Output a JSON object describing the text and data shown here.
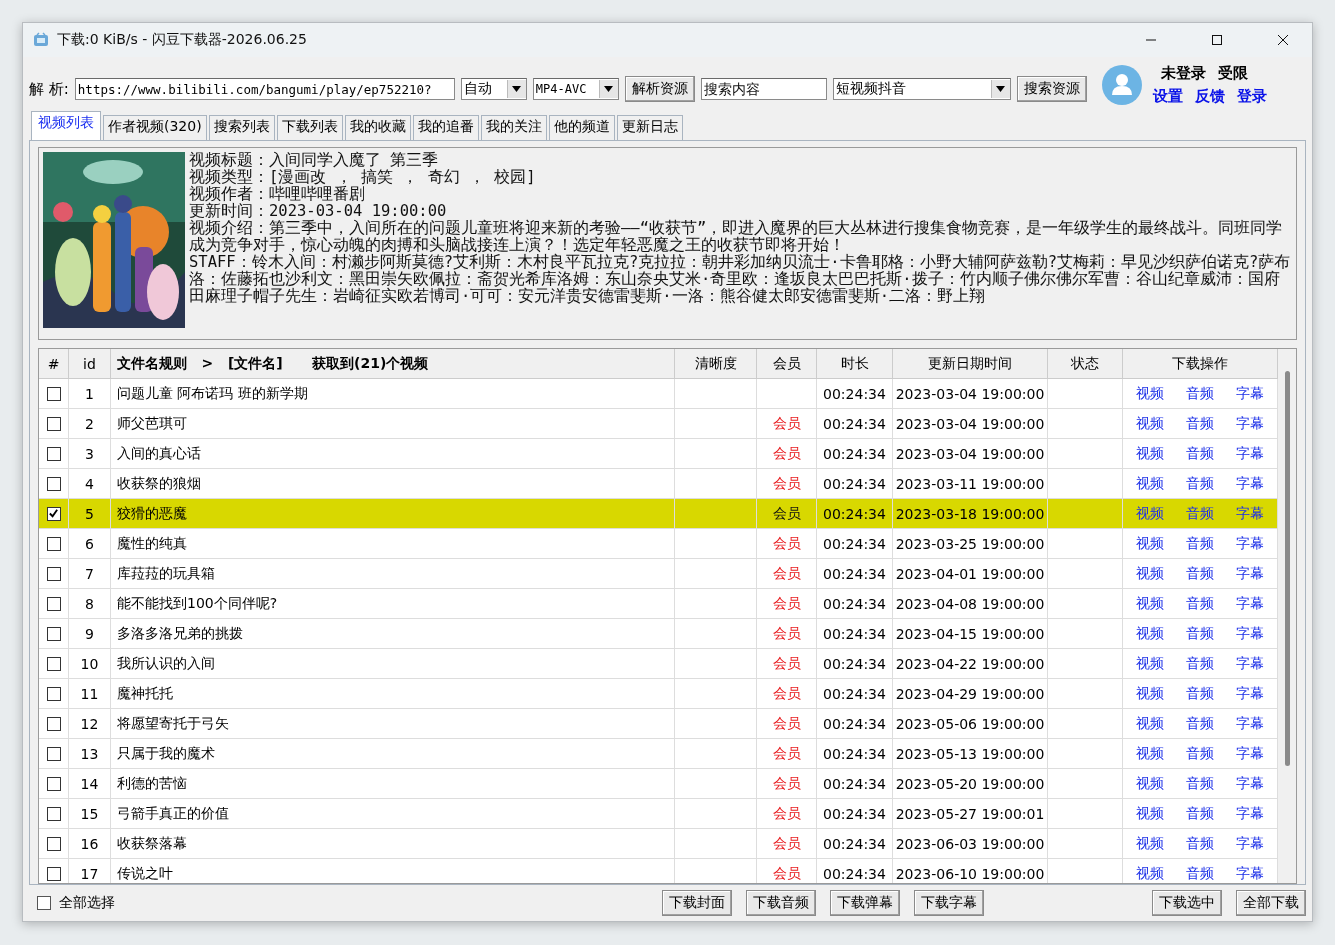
{
  "window": {
    "title": "下载:0 KiB/s - 闪豆下载器-2026.06.25"
  },
  "toolbar": {
    "parse_label": "解 析:",
    "url": "https://www.bilibili.com/bangumi/play/ep752210?",
    "quality": "自动",
    "codec": "MP4-AVC",
    "parse_button": "解析资源",
    "search_placeholder": "搜索内容",
    "platform": "短视频抖音",
    "search_button": "搜索资源"
  },
  "account": {
    "status": "未登录",
    "limit": "受限",
    "links": [
      "设置",
      "反馈",
      "登录"
    ]
  },
  "tabs": [
    {
      "label": "视频列表",
      "selected": true
    },
    {
      "label": "作者视频(320)",
      "selected": false
    },
    {
      "label": "搜索列表",
      "selected": false
    },
    {
      "label": "下载列表",
      "selected": false
    },
    {
      "label": "我的收藏",
      "selected": false
    },
    {
      "label": "我的追番",
      "selected": false
    },
    {
      "label": "我的关注",
      "selected": false
    },
    {
      "label": "他的频道",
      "selected": false
    },
    {
      "label": "更新日志",
      "selected": false
    }
  ],
  "info": {
    "lines": [
      "视频标题：入间同学入魔了 第三季",
      "视频类型：[漫画改 ， 搞笑 ， 奇幻 ， 校园]",
      "视频作者：哔哩哔哩番剧",
      "更新时间：2023-03-04 19:00:00",
      "视频介绍：第三季中，入间所在的问题儿童班将迎来新的考验——“收获节”，即进入魔界的巨大丛林进行搜集食物竞赛，是一年级学生的最终战斗。同班同学成为竞争对手，惊心动魄的肉搏和头脑战接连上演？！选定年轻恶魔之王的收获节即将开始！",
      "STAFF：铃木入间：村濑步阿斯莫德?艾利斯：木村良平瓦拉克?克拉拉：朝井彩加纳贝流士·卡鲁耶格：小野大辅阿萨兹勒?艾梅莉：早见沙织萨伯诺克?萨布洛：佐藤拓也沙利文：黑田崇矢欧佩拉：斋贺光希库洛姆：东山奈央艾米·奇里欧：逢坂良太巴巴托斯·拨子：竹内顺子佛尔佛尔军曹：谷山纪章威沛：国府田麻理子帽子先生：岩崎征实欧若博司·可可：安元洋贵安德雷斐斯·一洛：熊谷健太郎安德雷斐斯·二洛：野上翔"
    ]
  },
  "table": {
    "columns": [
      "#",
      "id",
      "文件名规则   >   [文件名]      获取到(21)个视频",
      "清晰度",
      "会员",
      "时长",
      "更新日期时间",
      "状态",
      "下载操作"
    ],
    "rows": [
      {
        "id": "1",
        "name": "问题儿童 阿布诺玛 班的新学期",
        "duration": "00:24:34",
        "date": "2023-03-04 19:00:00",
        "actions": [
          "视频",
          "音频",
          "字幕"
        ],
        "checked": false,
        "selected": false
      },
      {
        "id": "2",
        "name": "师父芭琪可",
        "member": "会员",
        "duration": "00:24:34",
        "date": "2023-03-04 19:00:00",
        "actions": [
          "视频",
          "音频",
          "字幕"
        ],
        "checked": false,
        "selected": false
      },
      {
        "id": "3",
        "name": "入间的真心话",
        "member": "会员",
        "duration": "00:24:34",
        "date": "2023-03-04 19:00:00",
        "actions": [
          "视频",
          "音频",
          "字幕"
        ],
        "checked": false,
        "selected": false
      },
      {
        "id": "4",
        "name": "收获祭的狼烟",
        "member": "会员",
        "duration": "00:24:34",
        "date": "2023-03-11 19:00:00",
        "actions": [
          "视频",
          "音频",
          "字幕"
        ],
        "checked": false,
        "selected": false
      },
      {
        "id": "5",
        "name": "狡猾的恶魔",
        "member": "会员",
        "duration": "00:24:34",
        "date": "2023-03-18 19:00:00",
        "actions": [
          "视频",
          "音频",
          "字幕"
        ],
        "checked": true,
        "selected": true
      },
      {
        "id": "6",
        "name": "魔性的纯真",
        "member": "会员",
        "duration": "00:24:34",
        "date": "2023-03-25 19:00:00",
        "actions": [
          "视频",
          "音频",
          "字幕"
        ],
        "checked": false,
        "selected": false
      },
      {
        "id": "7",
        "name": "库菈菈的玩具箱",
        "member": "会员",
        "duration": "00:24:34",
        "date": "2023-04-01 19:00:00",
        "actions": [
          "视频",
          "音频",
          "字幕"
        ],
        "checked": false,
        "selected": false
      },
      {
        "id": "8",
        "name": "能不能找到100个同伴呢?",
        "member": "会员",
        "duration": "00:24:34",
        "date": "2023-04-08 19:00:00",
        "actions": [
          "视频",
          "音频",
          "字幕"
        ],
        "checked": false,
        "selected": false
      },
      {
        "id": "9",
        "name": "多洛多洛兄弟的挑拨",
        "member": "会员",
        "duration": "00:24:34",
        "date": "2023-04-15 19:00:00",
        "actions": [
          "视频",
          "音频",
          "字幕"
        ],
        "checked": false,
        "selected": false
      },
      {
        "id": "10",
        "name": "我所认识的入间",
        "member": "会员",
        "duration": "00:24:34",
        "date": "2023-04-22 19:00:00",
        "actions": [
          "视频",
          "音频",
          "字幕"
        ],
        "checked": false,
        "selected": false
      },
      {
        "id": "11",
        "name": "魔神托托",
        "member": "会员",
        "duration": "00:24:34",
        "date": "2023-04-29 19:00:00",
        "actions": [
          "视频",
          "音频",
          "字幕"
        ],
        "checked": false,
        "selected": false
      },
      {
        "id": "12",
        "name": "将愿望寄托于弓矢",
        "member": "会员",
        "duration": "00:24:34",
        "date": "2023-05-06 19:00:00",
        "actions": [
          "视频",
          "音频",
          "字幕"
        ],
        "checked": false,
        "selected": false
      },
      {
        "id": "13",
        "name": "只属于我的魔术",
        "member": "会员",
        "duration": "00:24:34",
        "date": "2023-05-13 19:00:00",
        "actions": [
          "视频",
          "音频",
          "字幕"
        ],
        "checked": false,
        "selected": false
      },
      {
        "id": "14",
        "name": "利德的苦恼",
        "member": "会员",
        "duration": "00:24:34",
        "date": "2023-05-20 19:00:00",
        "actions": [
          "视频",
          "音频",
          "字幕"
        ],
        "checked": false,
        "selected": false
      },
      {
        "id": "15",
        "name": "弓箭手真正的价值",
        "member": "会员",
        "duration": "00:24:34",
        "date": "2023-05-27 19:00:01",
        "actions": [
          "视频",
          "音频",
          "字幕"
        ],
        "checked": false,
        "selected": false
      },
      {
        "id": "16",
        "name": "收获祭落幕",
        "member": "会员",
        "duration": "00:24:34",
        "date": "2023-06-03 19:00:00",
        "actions": [
          "视频",
          "音频",
          "字幕"
        ],
        "checked": false,
        "selected": false
      },
      {
        "id": "17",
        "name": "传说之叶",
        "member": "会员",
        "duration": "00:24:34",
        "date": "2023-06-10 19:00:00",
        "actions": [
          "视频",
          "音频",
          "字幕"
        ],
        "checked": false,
        "selected": false
      }
    ]
  },
  "footer": {
    "select_all": {
      "label": "全部选择",
      "checked": false
    },
    "buttons": [
      "下载封面",
      "下载音频",
      "下载弹幕",
      "下载字幕"
    ],
    "right_buttons": [
      "下载选中",
      "全部下载"
    ]
  }
}
